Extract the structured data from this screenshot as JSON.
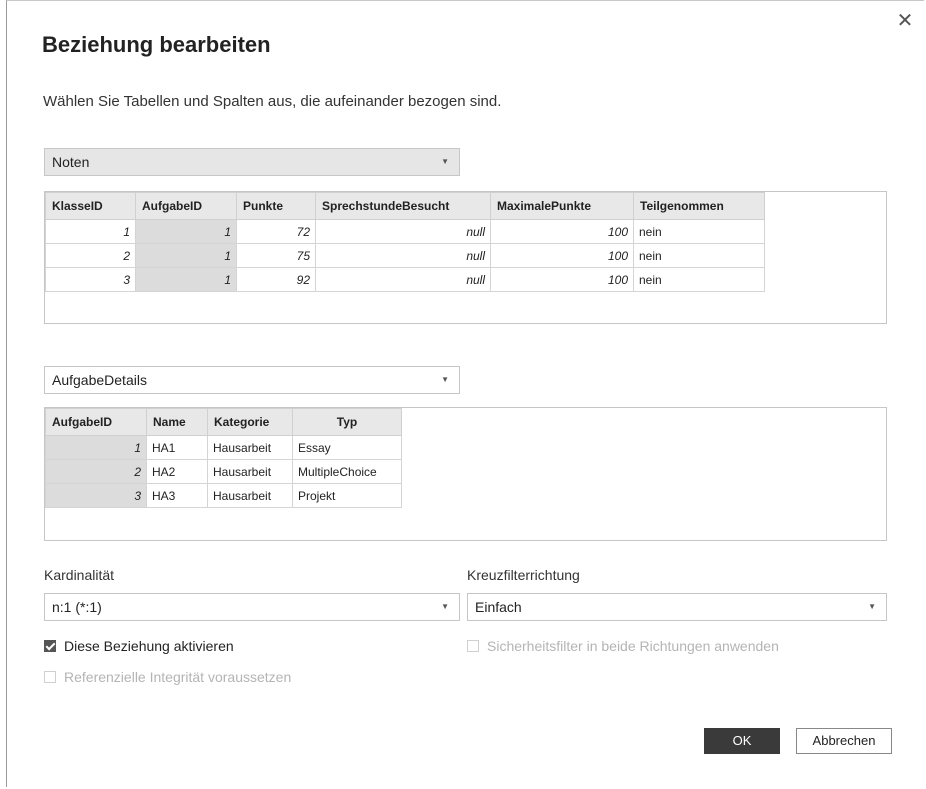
{
  "dialog": {
    "title": "Beziehung bearbeiten",
    "subtitle": "Wählen Sie Tabellen und Spalten aus, die aufeinander bezogen sind.",
    "close_glyph": "✕"
  },
  "table1": {
    "selected": "Noten",
    "columns": [
      "KlasseID",
      "AufgabeID",
      "Punkte",
      "SprechstundeBesucht",
      "MaximalePunkte",
      "Teilgenommen"
    ],
    "rows": [
      [
        "1",
        "1",
        "72",
        "null",
        "100",
        "nein"
      ],
      [
        "2",
        "1",
        "75",
        "null",
        "100",
        "nein"
      ],
      [
        "3",
        "1",
        "92",
        "null",
        "100",
        "nein"
      ]
    ],
    "highlighted_column": "AufgabeID"
  },
  "table2": {
    "selected": "AufgabeDetails",
    "columns": [
      "AufgabeID",
      "Name",
      "Kategorie",
      "Typ"
    ],
    "rows": [
      [
        "1",
        "HA1",
        "Hausarbeit",
        "Essay"
      ],
      [
        "2",
        "HA2",
        "Hausarbeit",
        "MultipleChoice"
      ],
      [
        "3",
        "HA3",
        "Hausarbeit",
        "Projekt"
      ]
    ],
    "highlighted_column": "AufgabeID"
  },
  "cardinality": {
    "label": "Kardinalität",
    "value": "n:1 (*:1)"
  },
  "crossfilter": {
    "label": "Kreuzfilterrichtung",
    "value": "Einfach"
  },
  "options": {
    "activate": {
      "label": "Diese Beziehung aktivieren",
      "checked": true
    },
    "security_filter": {
      "label": "Sicherheitsfilter in beide Richtungen anwenden",
      "checked": false,
      "disabled": true
    },
    "referential_integrity": {
      "label": "Referenzielle Integrität voraussetzen",
      "checked": false,
      "disabled": true
    }
  },
  "buttons": {
    "ok": "OK",
    "cancel": "Abbrechen"
  },
  "icons": {
    "dropdown": "chevron-down-icon",
    "close": "close-icon"
  }
}
